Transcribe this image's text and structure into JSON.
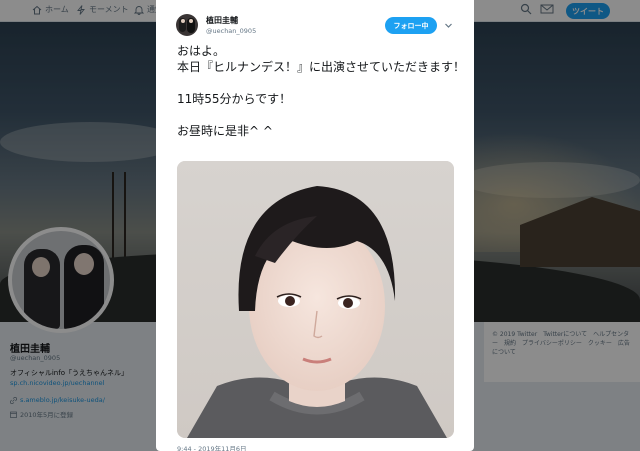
{
  "nav": {
    "home_label": "ホーム",
    "moments_label": "モーメント",
    "notifications_label": "通知",
    "tweet_button": "ツイート"
  },
  "profile": {
    "name": "植田圭輔",
    "handle": "@uechan_0905",
    "bio": "オフィシャルinfo「うえちゃんネル」",
    "link1": "sp.ch.nicovideo.jp/uechannel",
    "link2": "s.ameblo.jp/keisuke-ueda/",
    "joined": "2010年5月に登録"
  },
  "footer": {
    "text": "© 2019 Twitter　Twitterについて　ヘルプセンター　規約　プライバシーポリシー　クッキー　広告について"
  },
  "tweet": {
    "author_name": "植田圭輔",
    "author_handle": "@uechan_0905",
    "follow_label": "フォロー中",
    "text": "おはよ。\n本日『ヒルナンデス！』に出演させていただきます！\n\n11時55分からです！\n\nお昼時に是非^ ^",
    "timestamp": "9:44 - 2019年11月6日"
  },
  "colors": {
    "accent": "#1da1f2",
    "link": "#1b95e0",
    "muted": "#657786"
  },
  "icons": [
    "home-icon",
    "lightning-icon",
    "bell-icon",
    "search-icon",
    "envelope-icon",
    "chevron-down-icon",
    "link-icon",
    "calendar-icon"
  ]
}
